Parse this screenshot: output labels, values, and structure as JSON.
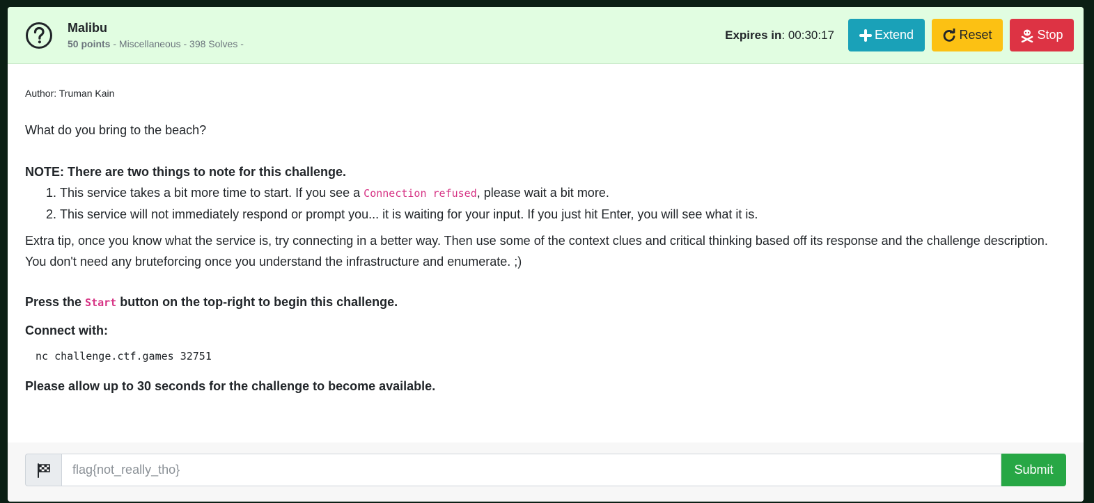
{
  "challenge": {
    "name": "Malibu",
    "points": "50 points",
    "meta_rest": " - Miscellaneous - 398 Solves -"
  },
  "header": {
    "expires_label": "Expires in",
    "expires_value": ": 00:30:17",
    "extend_label": "Extend",
    "reset_label": "Reset",
    "stop_label": "Stop"
  },
  "description": {
    "author": "Author: Truman Kain",
    "intro": "What do you bring to the beach?",
    "note_title": "NOTE: There are two things to note for this challenge.",
    "note_1_pre": "This service takes a bit more time to start. If you see a ",
    "note_1_code": "Connection refused",
    "note_1_post": ", please wait a bit more.",
    "note_2": "This service will not immediately respond or prompt you... it is waiting for your input. If you just hit Enter, you will see what it is.",
    "extra_tip": "Extra tip, once you know what the service is, try connecting in a better way. Then use some of the context clues and critical thinking based off its response and the challenge description. You don't need any bruteforcing once you understand the infrastructure and enumerate. ;)",
    "press_pre": "Press the ",
    "press_code": "Start",
    "press_post": " button on the top-right to begin this challenge.",
    "connect_label": "Connect with:",
    "connect_command": "nc challenge.ctf.games 32751",
    "allow_text": "Please allow up to 30 seconds for the challenge to become available."
  },
  "flag_form": {
    "placeholder": "flag{not_really_tho}",
    "submit_label": "Submit"
  },
  "colors": {
    "header_bg": "#e1fde1",
    "extend": "#1aa1b8",
    "reset": "#fcc113",
    "stop": "#dd3344",
    "submit": "#27a745",
    "code": "#d63384"
  },
  "icons": {
    "challenge": "question-circle-icon",
    "extend": "plus-icon",
    "reset": "redo-icon",
    "stop": "skull-crossbones-icon",
    "flag": "checkered-flag-icon"
  }
}
